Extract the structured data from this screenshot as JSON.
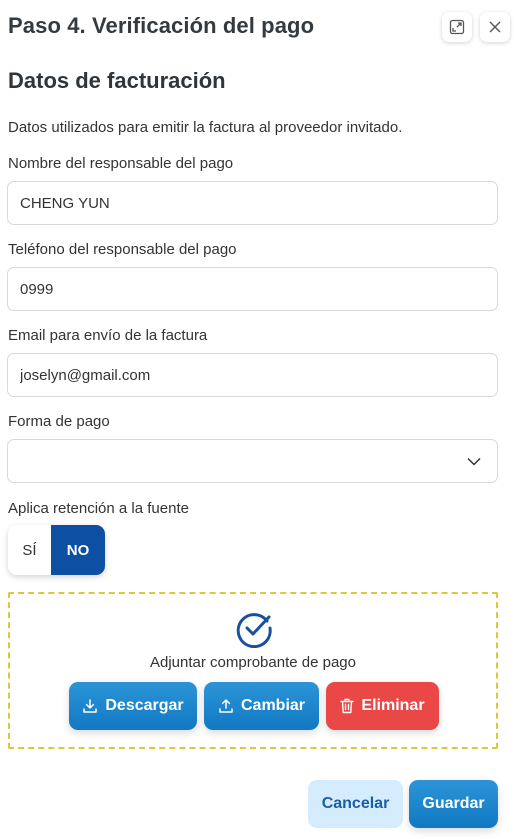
{
  "dialog": {
    "title": "Paso 4. Verificación del pago",
    "expand_icon": "expand-icon",
    "close_icon": "close-icon"
  },
  "billing": {
    "section_title": "Datos de facturación",
    "description": "Datos utilizados para emitir la factura al proveedor invitado.",
    "payer_name": {
      "label": "Nombre del responsable del pago",
      "value": "CHENG YUN"
    },
    "payer_phone": {
      "label": "Teléfono del responsable del pago",
      "value": "0999"
    },
    "invoice_email": {
      "label": "Email para envío de la factura",
      "value": "joselyn@gmail.com"
    },
    "payment_method": {
      "label": "Forma de pago",
      "value": ""
    },
    "withholding": {
      "label": "Aplica retención a la fuente",
      "yes": "SÍ",
      "no": "NO",
      "selected": "NO"
    }
  },
  "receipt": {
    "icon": "check-circle-icon",
    "text": "Adjuntar comprobante de pago",
    "download_label": "Descargar",
    "change_label": "Cambiar",
    "delete_label": "Eliminar"
  },
  "footer": {
    "cancel_label": "Cancelar",
    "save_label": "Guardar"
  },
  "colors": {
    "primary": "#1179c3",
    "toggle_active": "#0d4fa3",
    "danger": "#ea4747",
    "dashed_border": "#e0c63a",
    "cancel_bg": "#d4ecfb"
  }
}
